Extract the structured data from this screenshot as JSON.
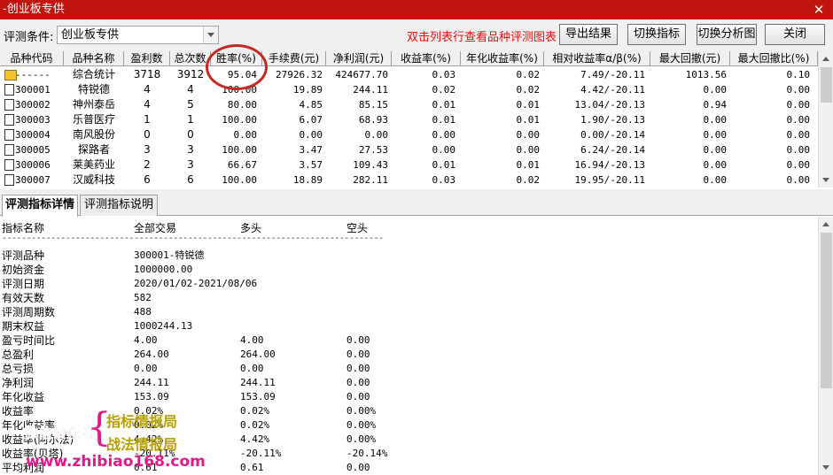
{
  "window": {
    "title": "-创业板专供"
  },
  "toolbar": {
    "condition_label": "评测条件:",
    "condition_value": "创业板专供",
    "hint": "双击列表行查看品种评测图表",
    "buttons": [
      "导出结果",
      "切换指标",
      "切换分析图",
      "关闭"
    ]
  },
  "grid": {
    "columns": [
      "品种代码",
      "品种名称",
      "盈利数",
      "总次数",
      "胜率(%)",
      "手续费(元)",
      "净利润(元)",
      "收益率(%)",
      "年化收益率(%)",
      "相对收益率α/β(%)",
      "最大回撤(元)",
      "最大回撤比(%)"
    ],
    "rows": [
      {
        "icon": "folder-icon",
        "code": "------",
        "name": "综合统计",
        "win": "3718",
        "total": "3912",
        "rate": "95.04",
        "fee": "27926.32",
        "profit": "424677.70",
        "ret": "0.03",
        "annual": "0.02",
        "alpha": "7.49/-20.11",
        "dd": "1013.56",
        "ddr": "0.10"
      },
      {
        "icon": "doc-icon",
        "code": "300001",
        "name": "特锐德",
        "win": "4",
        "total": "4",
        "rate": "100.00",
        "fee": "19.89",
        "profit": "244.11",
        "ret": "0.02",
        "annual": "0.02",
        "alpha": "4.42/-20.11",
        "dd": "0.00",
        "ddr": "0.00"
      },
      {
        "icon": "doc-icon",
        "code": "300002",
        "name": "神州泰岳",
        "win": "4",
        "total": "5",
        "rate": "80.00",
        "fee": "4.85",
        "profit": "85.15",
        "ret": "0.01",
        "annual": "0.01",
        "alpha": "13.04/-20.13",
        "dd": "0.94",
        "ddr": "0.00"
      },
      {
        "icon": "doc-icon",
        "code": "300003",
        "name": "乐普医疗",
        "win": "1",
        "total": "1",
        "rate": "100.00",
        "fee": "6.07",
        "profit": "68.93",
        "ret": "0.01",
        "annual": "0.01",
        "alpha": "1.90/-20.13",
        "dd": "0.00",
        "ddr": "0.00"
      },
      {
        "icon": "doc-icon",
        "code": "300004",
        "name": "南风股份",
        "win": "0",
        "total": "0",
        "rate": "0.00",
        "fee": "0.00",
        "profit": "0.00",
        "ret": "0.00",
        "annual": "0.00",
        "alpha": "0.00/-20.14",
        "dd": "0.00",
        "ddr": "0.00"
      },
      {
        "icon": "doc-icon",
        "code": "300005",
        "name": "探路者",
        "win": "3",
        "total": "3",
        "rate": "100.00",
        "fee": "3.47",
        "profit": "27.53",
        "ret": "0.00",
        "annual": "0.00",
        "alpha": "6.24/-20.14",
        "dd": "0.00",
        "ddr": "0.00"
      },
      {
        "icon": "doc-icon",
        "code": "300006",
        "name": "莱美药业",
        "win": "2",
        "total": "3",
        "rate": "66.67",
        "fee": "3.57",
        "profit": "109.43",
        "ret": "0.01",
        "annual": "0.01",
        "alpha": "16.94/-20.13",
        "dd": "0.00",
        "ddr": "0.00"
      },
      {
        "icon": "doc-icon",
        "code": "300007",
        "name": "汉威科技",
        "win": "6",
        "total": "6",
        "rate": "100.00",
        "fee": "18.89",
        "profit": "282.11",
        "ret": "0.03",
        "annual": "0.02",
        "alpha": "19.95/-20.11",
        "dd": "0.00",
        "ddr": "0.00"
      }
    ]
  },
  "tabs": [
    "评测指标详情",
    "评测指标说明"
  ],
  "detail": {
    "headers": [
      "指标名称",
      "全部交易",
      "多头",
      "空头"
    ],
    "separator": "------------------------------------------------------------------------------",
    "rows": [
      {
        "label": "评测品种",
        "v": [
          "300001-特锐德",
          "",
          ""
        ]
      },
      {
        "label": "初始资金",
        "v": [
          "1000000.00",
          "",
          ""
        ]
      },
      {
        "label": "评测日期",
        "v": [
          "2020/01/02-2021/08/06",
          "",
          ""
        ]
      },
      {
        "label": "有效天数",
        "v": [
          "582",
          "",
          ""
        ]
      },
      {
        "label": "评测周期数",
        "v": [
          "488",
          "",
          ""
        ]
      },
      {
        "label": "期末权益",
        "v": [
          "1000244.13",
          "",
          ""
        ]
      },
      {
        "label": "盈亏时间比",
        "v": [
          "4.00",
          "4.00",
          "0.00"
        ]
      },
      {
        "label": "总盈利",
        "v": [
          "264.00",
          "264.00",
          "0.00"
        ]
      },
      {
        "label": "总亏损",
        "v": [
          "0.00",
          "0.00",
          "0.00"
        ]
      },
      {
        "label": "净利润",
        "v": [
          "244.11",
          "244.11",
          "0.00"
        ]
      },
      {
        "label": "年化收益",
        "v": [
          "153.09",
          "153.09",
          "0.00"
        ]
      },
      {
        "label": "收益率",
        "v": [
          "0.02%",
          "0.02%",
          "0.00%"
        ]
      },
      {
        "label": "年化收益率",
        "v": [
          "0.02%",
          "0.02%",
          "0.00%"
        ]
      },
      {
        "label": "收益率(阿尔法)",
        "v": [
          "4.42%",
          "4.42%",
          "0.00%"
        ]
      },
      {
        "label": "收益率(贝塔)",
        "v": [
          "-20.11%",
          "-20.11%",
          "-20.14%"
        ]
      },
      {
        "label": "平均利润",
        "v": [
          "0.61",
          "0.61",
          "0.00"
        ]
      }
    ]
  },
  "watermark": {
    "left": "微信公众号",
    "right1": "指标情报局",
    "right2": "战法情报局",
    "url": "www.zhibiao168.com"
  },
  "colors": {
    "titlebar": "#c0150f",
    "hint": "#e01010",
    "highlight_ellipse": "#c42a22"
  }
}
